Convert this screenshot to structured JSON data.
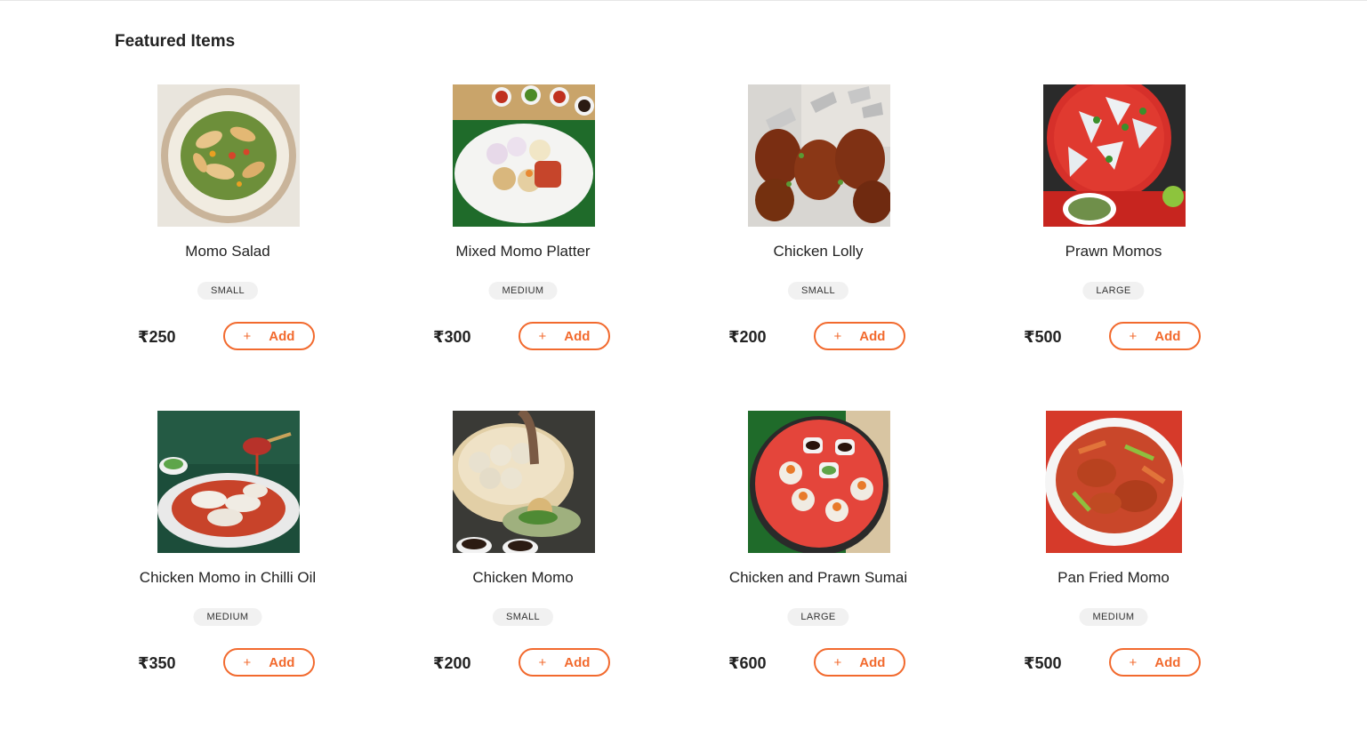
{
  "section": {
    "title": "Featured Items"
  },
  "add_icon": "plus-icon",
  "accent_color": "#f26a2e",
  "items": [
    {
      "name": "Momo Salad",
      "size": "SMALL",
      "price": "₹250",
      "add_label": "Add",
      "plus": "+"
    },
    {
      "name": "Mixed Momo Platter",
      "size": "MEDIUM",
      "price": "₹300",
      "add_label": "Add",
      "plus": "+"
    },
    {
      "name": "Chicken Lolly",
      "size": "SMALL",
      "price": "₹200",
      "add_label": "Add",
      "plus": "+"
    },
    {
      "name": "Prawn Momos",
      "size": "LARGE",
      "price": "₹500",
      "add_label": "Add",
      "plus": "+"
    },
    {
      "name": "Chicken Momo in Chilli Oil",
      "size": "MEDIUM",
      "price": "₹350",
      "add_label": "Add",
      "plus": "+"
    },
    {
      "name": "Chicken Momo",
      "size": "SMALL",
      "price": "₹200",
      "add_label": "Add",
      "plus": "+"
    },
    {
      "name": "Chicken and Prawn Sumai",
      "size": "LARGE",
      "price": "₹600",
      "add_label": "Add",
      "plus": "+"
    },
    {
      "name": "Pan Fried Momo",
      "size": "MEDIUM",
      "price": "₹500",
      "add_label": "Add",
      "plus": "+"
    }
  ]
}
